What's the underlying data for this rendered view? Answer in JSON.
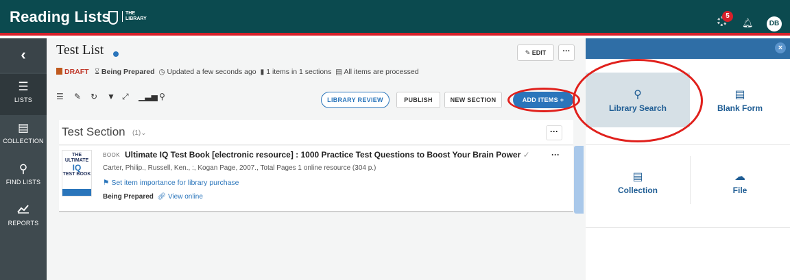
{
  "header": {
    "brand": "Reading Lists",
    "library_mark_line1": "THE",
    "library_mark_line2": "LIBRARY",
    "notifications_count": "5",
    "user_initials": "DB"
  },
  "sidebar": {
    "back_glyph": "‹",
    "items": [
      {
        "label": "LISTS",
        "icon": "list-icon"
      },
      {
        "label": "COLLECTION",
        "icon": "folder-icon"
      },
      {
        "label": "FIND LISTS",
        "icon": "search-icon"
      },
      {
        "label": "REPORTS",
        "icon": "chart-icon"
      }
    ]
  },
  "list": {
    "title": "Test List",
    "draft": "DRAFT",
    "state": "Being Prepared",
    "updated": "Updated a few seconds ago",
    "items_info": "1 items in 1 sections",
    "processed": "All items are processed",
    "edit_label": "EDIT",
    "more_label": "···",
    "library_review": "LIBRARY REVIEW",
    "publish": "PUBLISH",
    "new_section": "NEW SECTION",
    "add_items": "ADD ITEMS"
  },
  "section": {
    "title": "Test Section",
    "count": "(1)",
    "more_label": "···"
  },
  "item": {
    "type": "BOOK",
    "title": "Ultimate IQ Test Book [electronic resource] : 1000 Practice Test Questions to Boost Your Brain Power",
    "meta": "Carter, Philip., Russell, Ken., :, Kogan Page, 2007., Total Pages 1 online resource (304 p.)",
    "importance": "Set item importance for library purchase",
    "status": "Being Prepared",
    "view_online": "View online",
    "more_label": "···",
    "cover_line1": "THE",
    "cover_line2": "ULTIMATE",
    "cover_line3": "IQ",
    "cover_line4": "TEST BOOK"
  },
  "panel": {
    "close_label": "×",
    "tiles": [
      {
        "label": "Library Search",
        "icon": "search-icon"
      },
      {
        "label": "Blank Form",
        "icon": "form-icon"
      },
      {
        "label": "Collection",
        "icon": "folder-icon"
      },
      {
        "label": "File",
        "icon": "upload-icon"
      }
    ]
  },
  "colors": {
    "header": "#0b4a4f",
    "accent_red": "#d7202a",
    "sidebar": "#3f4a4f",
    "link_blue": "#2a75bb",
    "annotation_red": "#e0201c"
  }
}
